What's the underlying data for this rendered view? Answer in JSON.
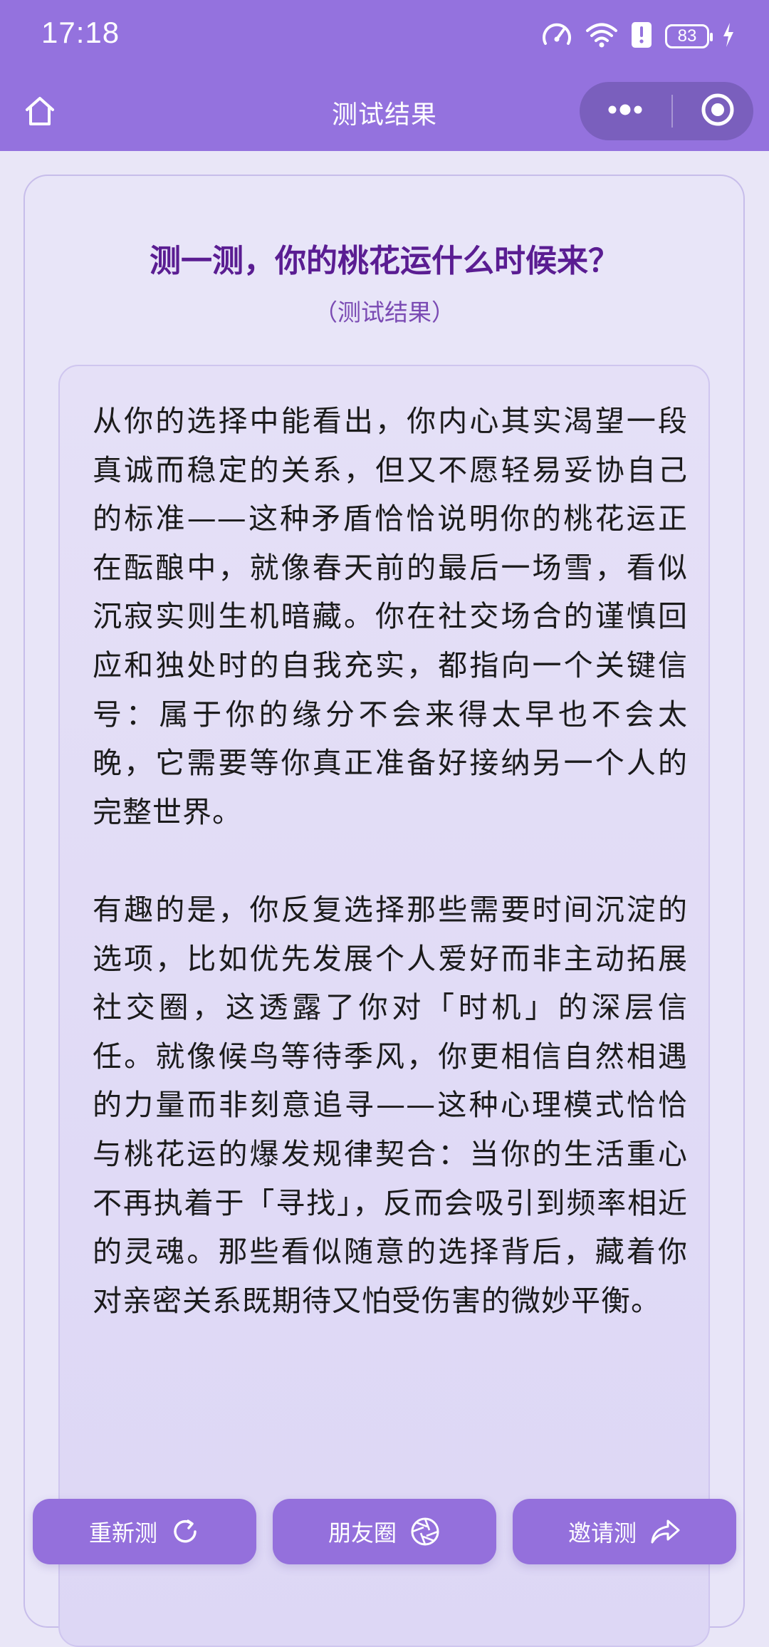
{
  "status_bar": {
    "time": "17:18",
    "battery": "83",
    "icons": [
      "speedometer-icon",
      "wifi-icon",
      "alert-icon",
      "battery-icon",
      "charging-icon"
    ]
  },
  "nav": {
    "title": "测试结果",
    "home_icon": "home-icon",
    "more_icon": "more-dots-icon",
    "close_icon": "record-circle-icon"
  },
  "card": {
    "title": "测一测，你的桃花运什么时候来？",
    "subtitle": "（测试结果）"
  },
  "result": {
    "paragraphs": [
      "从你的选择中能看出，你内心其实渴望一段真诚而稳定的关系，但又不愿轻易妥协自己的标准——这种矛盾恰恰说明你的桃花运正在酝酿中，就像春天前的最后一场雪，看似沉寂实则生机暗藏。你在社交场合的谨慎回应和独处时的自我充实，都指向一个关键信号：属于你的缘分不会来得太早也不会太晚，它需要等你真正准备好接纳另一个人的完整世界。",
      "有趣的是，你反复选择那些需要时间沉淀的选项，比如优先发展个人爱好而非主动拓展社交圈，这透露了你对「时机」的深层信任。就像候鸟等待季风，你更相信自然相遇的力量而非刻意追寻——这种心理模式恰恰与桃花运的爆发规律契合：当你的生活重心不再执着于「寻找」，反而会吸引到频率相近的灵魂。那些看似随意的选择背后，藏着你对亲密关系既期待又怕受伤害的微妙平衡。"
    ]
  },
  "buttons": {
    "retest": "重新测",
    "moments": "朋友圈",
    "invite": "邀请测"
  }
}
